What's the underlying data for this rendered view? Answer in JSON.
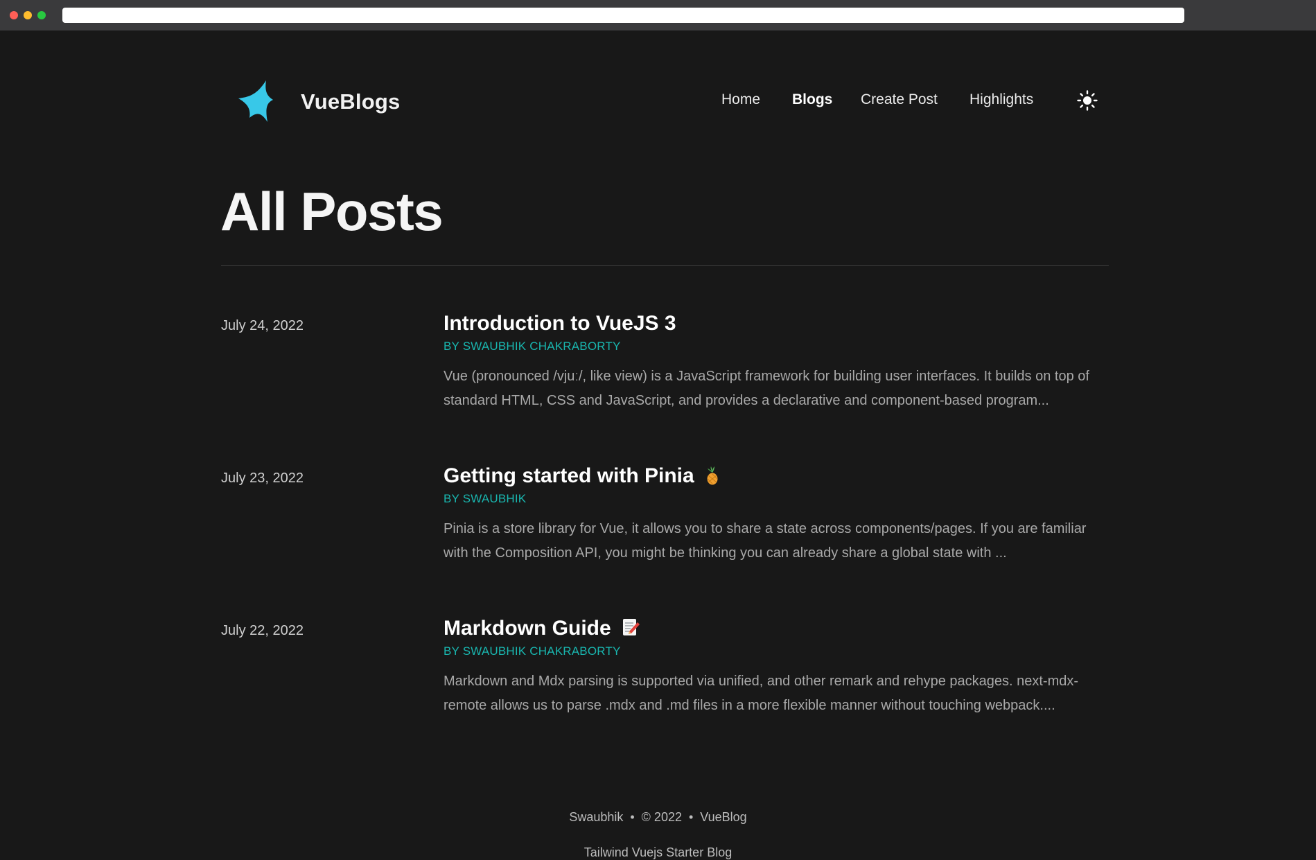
{
  "site": {
    "brand": "VueBlogs",
    "accent_color": "#38c8e8",
    "author_color": "#19b7b0"
  },
  "nav": {
    "items": [
      {
        "label": "Home",
        "active": false
      },
      {
        "label": "Blogs",
        "active": true
      },
      {
        "label": "Create Post",
        "active": false
      },
      {
        "label": "Highlights",
        "active": false
      }
    ],
    "theme_icon": "sun-icon"
  },
  "main": {
    "title": "All Posts",
    "posts": [
      {
        "date": "July 24, 2022",
        "title": "Introduction to VueJS 3",
        "emoji": "",
        "author": "BY SWAUBHIK CHAKRABORTY",
        "excerpt": "Vue (pronounced /vjuː/, like view) is a JavaScript framework for building user interfaces. It builds on top of standard HTML, CSS and JavaScript, and provides a declarative and component-based program..."
      },
      {
        "date": "July 23, 2022",
        "title": "Getting started with Pinia",
        "emoji": "pineapple-icon",
        "author": "BY SWAUBHIK",
        "excerpt": "Pinia is a store library for Vue, it allows you to share a state across components/pages. If you are familiar with the Composition API, you might be thinking you can already share a global state with ..."
      },
      {
        "date": "July 22, 2022",
        "title": "Markdown Guide",
        "emoji": "memo-icon",
        "author": "BY SWAUBHIK CHAKRABORTY",
        "excerpt": "Markdown and Mdx parsing is supported via unified, and other remark and rehype packages. next-mdx-remote allows us to parse .mdx and .md files in a more flexible manner without touching webpack...."
      }
    ]
  },
  "footer": {
    "author": "Swaubhik",
    "separator": "•",
    "copyright": "© 2022",
    "site": "VueBlog",
    "tagline": "Tailwind Vuejs Starter Blog"
  }
}
